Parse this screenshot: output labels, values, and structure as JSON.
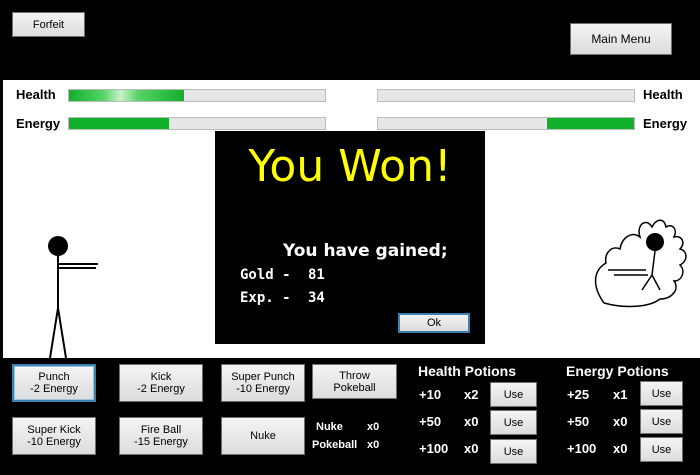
{
  "top": {
    "forfeit": "Forfeit",
    "main_menu": "Main Menu"
  },
  "status": {
    "health_label": "Health",
    "energy_label": "Energy",
    "player": {
      "health": 0.45,
      "energy": 0.39
    },
    "enemy": {
      "health": 0.0,
      "energy": 0.34
    }
  },
  "result": {
    "title": "You Won!",
    "gained": "You have gained;",
    "gold_label": "Gold -",
    "gold": "81",
    "exp_label": "Exp. -",
    "exp": "34",
    "ok": "Ok"
  },
  "moves": {
    "punch": "Punch\n-2 Energy",
    "kick": "Kick\n-2 Energy",
    "super_punch": "Super Punch\n-10 Energy",
    "throw_pokeball": "Throw\nPokeball",
    "super_kick": "Super Kick\n-10 Energy",
    "fire_ball": "Fire Ball\n-15 Energy",
    "nuke": "Nuke"
  },
  "inventory": {
    "nuke_label": "Nuke",
    "nuke_count": "x0",
    "pokeball_label": "Pokeball",
    "pokeball_count": "x0"
  },
  "health_potions": {
    "title": "Health Potions",
    "items": [
      {
        "amount": "+10",
        "count": "x2",
        "use": "Use"
      },
      {
        "amount": "+50",
        "count": "x0",
        "use": "Use"
      },
      {
        "amount": "+100",
        "count": "x0",
        "use": "Use"
      }
    ]
  },
  "energy_potions": {
    "title": "Energy Potions",
    "items": [
      {
        "amount": "+25",
        "count": "x1",
        "use": "Use"
      },
      {
        "amount": "+50",
        "count": "x0",
        "use": "Use"
      },
      {
        "amount": "+100",
        "count": "x0",
        "use": "Use"
      }
    ]
  },
  "colors": {
    "bar_fill": "#10b02a",
    "title": "#ffff00",
    "focus": "#3c7fb1"
  }
}
